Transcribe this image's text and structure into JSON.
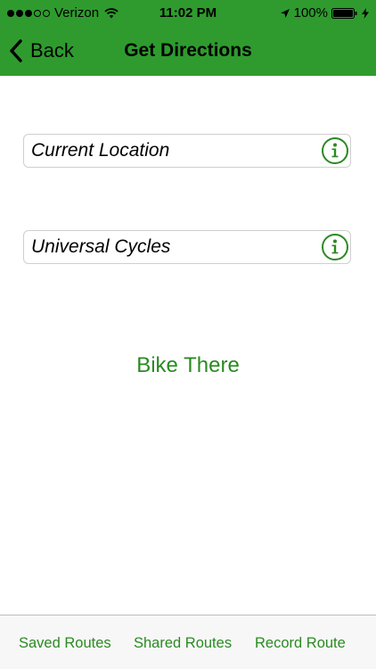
{
  "status_bar": {
    "carrier": "Verizon",
    "time": "11:02 PM",
    "battery": "100%"
  },
  "nav": {
    "back_label": "Back",
    "title": "Get Directions"
  },
  "fields": {
    "start": {
      "value": "Current Location"
    },
    "destination": {
      "value": "Universal Cycles"
    }
  },
  "action": {
    "bike_label": "Bike There"
  },
  "tabs": [
    {
      "label": "Saved Routes"
    },
    {
      "label": "Shared Routes"
    },
    {
      "label": "Record Route"
    }
  ],
  "colors": {
    "header": "#2f9b2e",
    "accent": "#2a8a22"
  }
}
